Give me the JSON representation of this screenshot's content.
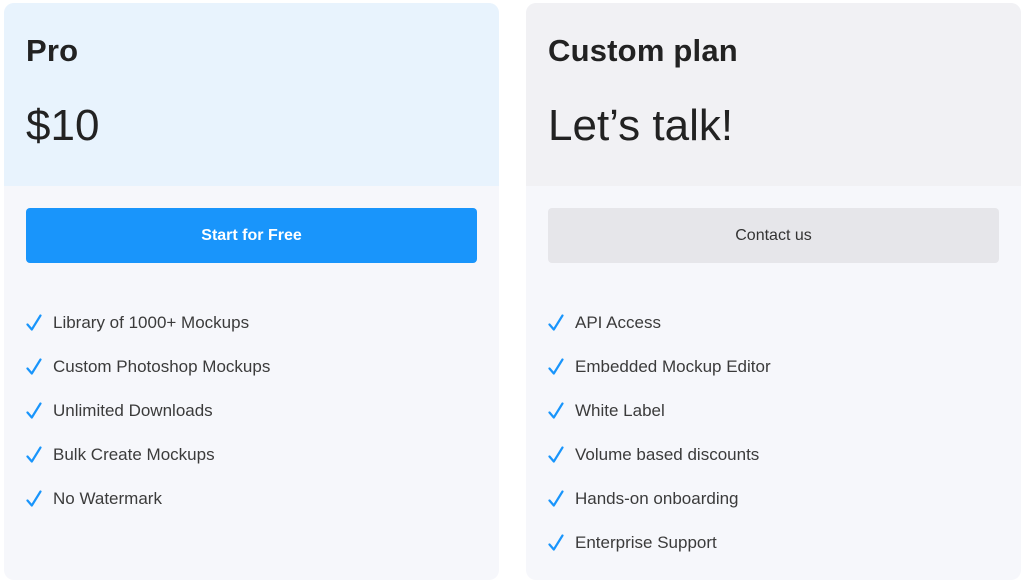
{
  "plans": [
    {
      "name": "Pro",
      "price": "$10",
      "cta_label": "Start for Free",
      "features": [
        "Library of 1000+ Mockups",
        "Custom Photoshop Mockups",
        "Unlimited Downloads",
        "Bulk Create Mockups",
        "No Watermark"
      ]
    },
    {
      "name": "Custom plan",
      "price": "Let’s talk!",
      "cta_label": "Contact us",
      "features": [
        "API Access",
        "Embedded Mockup Editor",
        "White Label",
        "Volume based discounts",
        "Hands-on onboarding",
        "Enterprise Support"
      ]
    }
  ],
  "colors": {
    "accent": "#1995fb",
    "check": "#1995fb"
  },
  "icons": {
    "feature_bullet": "check-icon"
  }
}
